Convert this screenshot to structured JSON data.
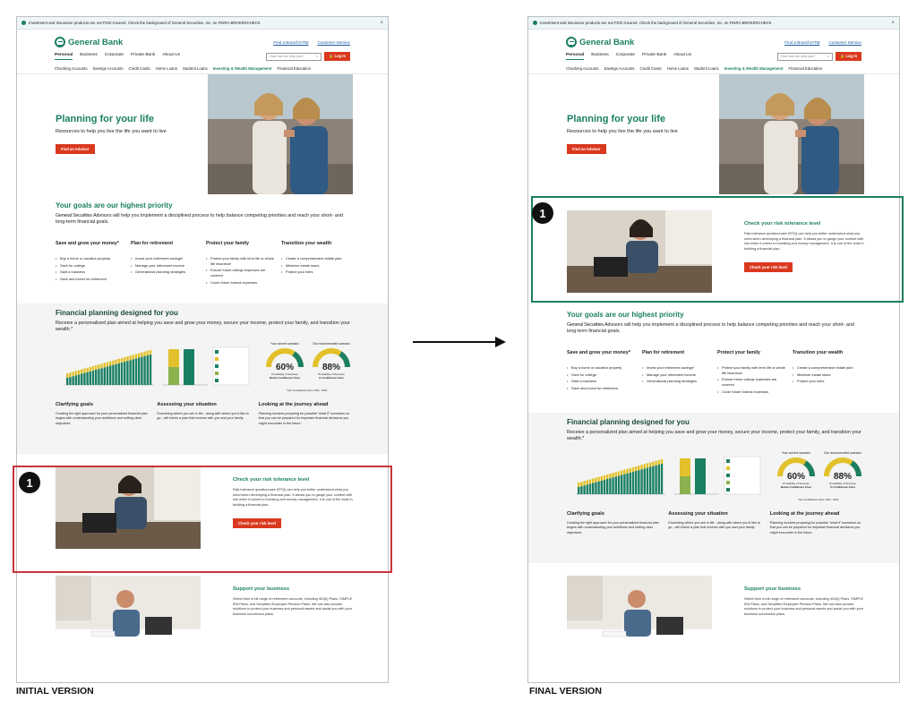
{
  "colors": {
    "brand": "#1a7f63",
    "cta": "#d9381e",
    "highlight_initial": "#c8343a",
    "highlight_final": "#1a7f63"
  },
  "labels": {
    "initial": "INITIAL VERSION",
    "final": "FINAL VERSION"
  },
  "callout_number": "1",
  "banner": {
    "text": "Investment and Insurance products are not FDIC-insured. Check the background of General Securities, Inc. on FINRA BROKERCHECK",
    "link": "FINRA BROKERCHECK",
    "close_icon": "close-icon"
  },
  "header": {
    "bank_name": "General Bank",
    "find_branch": "Find a Branch/ATM",
    "customer_service": "Customer Service",
    "primary_nav": [
      "Personal",
      "Business",
      "Corporate",
      "Private Bank",
      "About Us"
    ],
    "search_placeholder": "How can we help you?",
    "login": "Log In",
    "secondary_nav": [
      "Checking Accounts",
      "Savings Accounts",
      "Credit Cards",
      "Home Loans",
      "Student Loans",
      "Investing & Wealth Management",
      "Financial Education"
    ]
  },
  "hero": {
    "title": "Planning for your life",
    "subtitle": "Resources to help you live the life you want to live",
    "cta": "Find an Advisor"
  },
  "goals": {
    "title": "Your goals are our highest priority",
    "brand": "General Securities",
    "intro": "Advisors will help you implement a disciplined process to help balance competing priorities and reach your short- and long-term financial goals.",
    "columns": [
      {
        "heading": "Save and grow your money*",
        "items": [
          "Buy a home or vacation property",
          "Save for college",
          "Start a business",
          "Save and invest for retirement"
        ]
      },
      {
        "heading": "Plan for retirement",
        "items": [
          "Invest your retirement savings*",
          "Manage your retirement income",
          "Generational planning strategies"
        ]
      },
      {
        "heading": "Protect your family",
        "items": [
          "Protect your family with term life or whole life insurance",
          "Ensure future college expenses are covered",
          "Cover future funeral expenses"
        ]
      },
      {
        "heading": "Transition your wealth",
        "items": [
          "Create a comprehensive estate plan",
          "Minimize estate taxes",
          "Protect your heirs"
        ]
      }
    ]
  },
  "financial_planning": {
    "title": "Financial planning designed for you",
    "intro": "Receive a personalized plan aimed at helping you save and grow your money, secure your income, protect your family, and transition your wealth.*",
    "gauges": [
      {
        "caption": "Your current scenario",
        "value": "60%",
        "sub1": "Probability of Success",
        "sub2": "Below Confidence Zone",
        "fraction": 0.6
      },
      {
        "caption": "Our recommended scenario",
        "value": "88%",
        "sub1": "Probability of Success",
        "sub2": "In Confidence Zone",
        "fraction": 0.88
      }
    ],
    "zone_label": "Your Confidence Zone 70% - 90%",
    "columns": [
      {
        "heading": "Clarifying goals",
        "text": "Creating the right approach for your personalized financial plan begins with understanding your ambitions and setting clear objectives."
      },
      {
        "heading": "Assessing your situation",
        "text": "Examining where you are in life - along with where you'd like to go - will inform a plan that evolves with you and your family."
      },
      {
        "heading": "Looking at the journey ahead",
        "text": "Planning involves preparing for possible \"what if\" scenarios so that you can be prepared for important financial decisions you might encounter in the future."
      }
    ]
  },
  "risk": {
    "title": "Check your risk tolerance level",
    "text": "Risk tolerance questionnaire (RTQ) can help you better understand what you need when developing a financial plan. It allows you to gauge your comfort with risk when it comes to investing and money management. It is one of the tools in building a financial plan.",
    "cta": "Check your risk level"
  },
  "business": {
    "title": "Support your business",
    "text": "Select from a full range of retirement accounts, including 401(k) Plans, SIMPLE IRA Plans, and Simplified Employee Pension Plans. We can also provide solutions to protect your business and personal assets and assist you with your business succession plans."
  }
}
